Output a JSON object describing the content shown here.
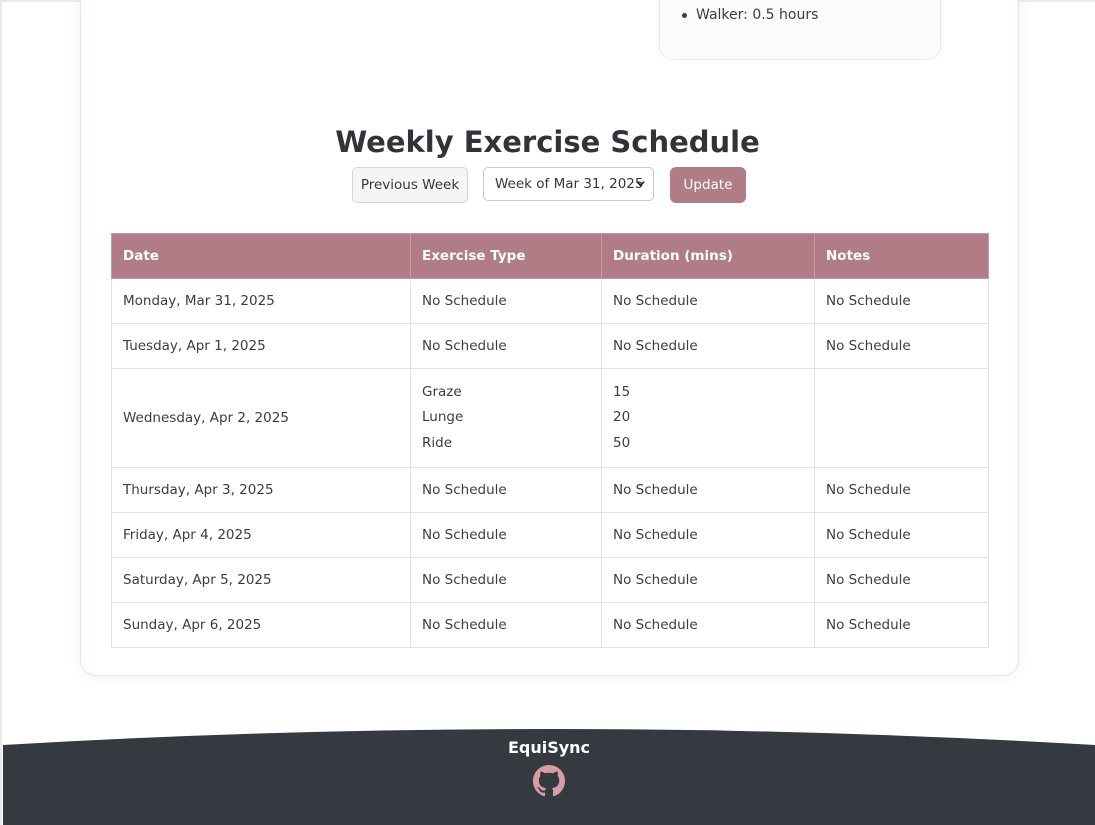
{
  "summary": {
    "items": [
      "Walker: 0.5 hours"
    ]
  },
  "schedule": {
    "title": "Weekly Exercise Schedule",
    "prev_label": "Previous Week",
    "week_selected": "Week of Mar 31, 2025",
    "update_label": "Update",
    "columns": [
      "Date",
      "Exercise Type",
      "Duration (mins)",
      "Notes"
    ],
    "rows": [
      {
        "date": "Monday, Mar 31, 2025",
        "type": [
          "No Schedule"
        ],
        "duration": [
          "No Schedule"
        ],
        "notes": "No Schedule"
      },
      {
        "date": "Tuesday, Apr 1, 2025",
        "type": [
          "No Schedule"
        ],
        "duration": [
          "No Schedule"
        ],
        "notes": "No Schedule"
      },
      {
        "date": "Wednesday, Apr 2, 2025",
        "type": [
          "Graze",
          "Lunge",
          "Ride"
        ],
        "duration": [
          "15",
          "20",
          "50"
        ],
        "notes": ""
      },
      {
        "date": "Thursday, Apr 3, 2025",
        "type": [
          "No Schedule"
        ],
        "duration": [
          "No Schedule"
        ],
        "notes": "No Schedule"
      },
      {
        "date": "Friday, Apr 4, 2025",
        "type": [
          "No Schedule"
        ],
        "duration": [
          "No Schedule"
        ],
        "notes": "No Schedule"
      },
      {
        "date": "Saturday, Apr 5, 2025",
        "type": [
          "No Schedule"
        ],
        "duration": [
          "No Schedule"
        ],
        "notes": "No Schedule"
      },
      {
        "date": "Sunday, Apr 6, 2025",
        "type": [
          "No Schedule"
        ],
        "duration": [
          "No Schedule"
        ],
        "notes": "No Schedule"
      }
    ]
  },
  "footer": {
    "brand": "EquiSync",
    "icon": "github-icon"
  },
  "colors": {
    "accent": "#b07c85",
    "footer_bg": "#343a40",
    "icon": "#d79ca6"
  }
}
